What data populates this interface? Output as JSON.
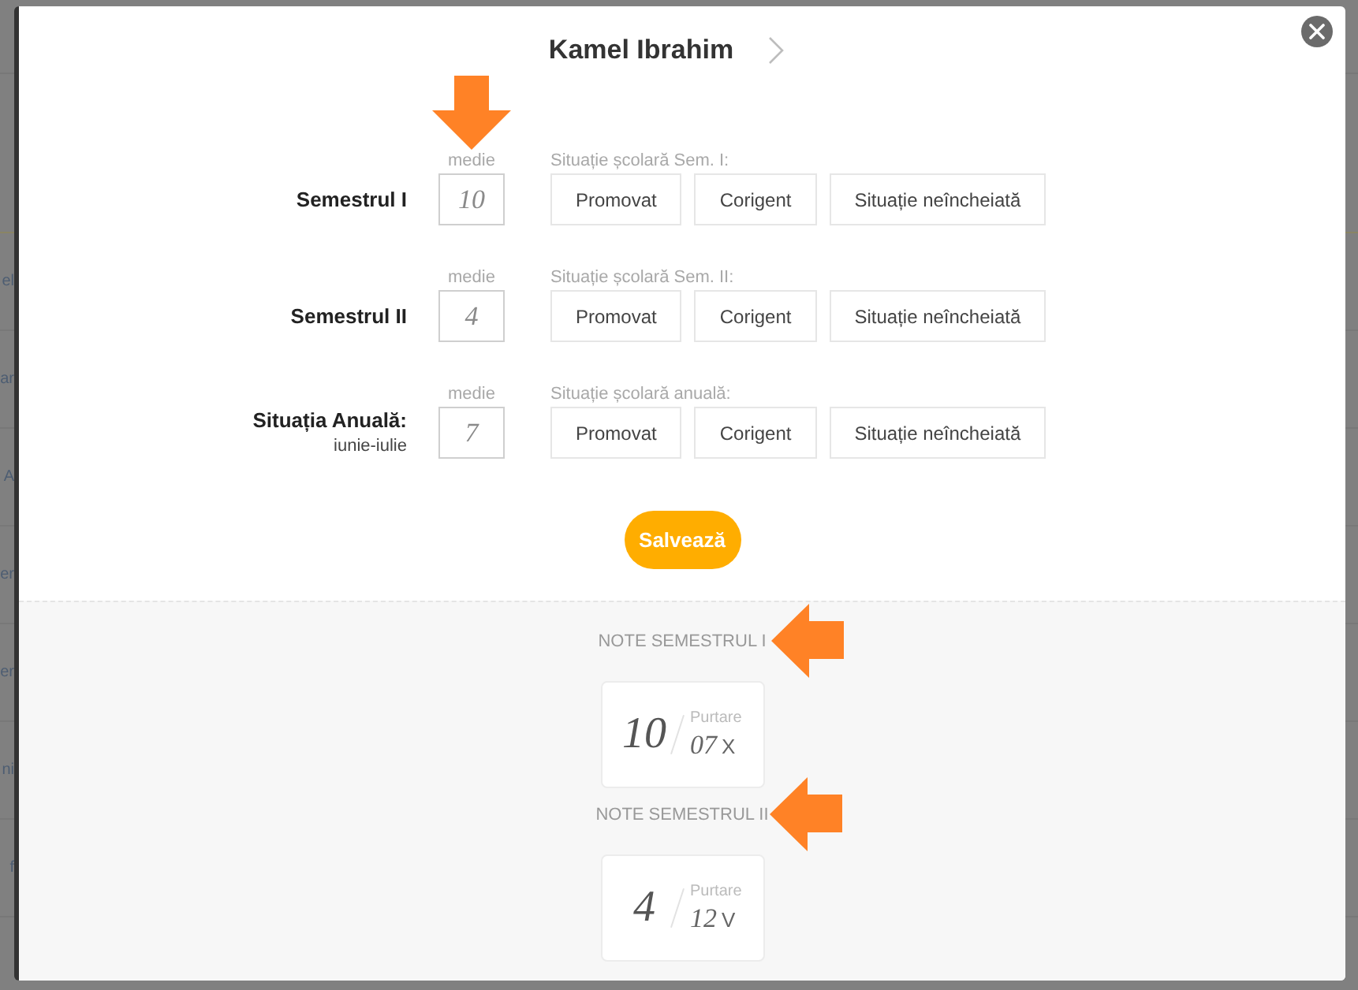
{
  "background_page": {
    "fragments": [
      "el",
      "ar",
      "A",
      "er",
      "er",
      "ni",
      "f"
    ]
  },
  "dialog": {
    "title": "Kamel Ibrahim"
  },
  "rows": [
    {
      "label": "Semestrul I",
      "average_label": "medie",
      "average": "10",
      "status_label": "Situație școlară Sem. I:",
      "options": [
        {
          "label": "Promovat",
          "selected": false
        },
        {
          "label": "Corigent",
          "selected": false
        },
        {
          "label": "Situație neîncheiată",
          "selected": false
        }
      ]
    },
    {
      "label": "Semestrul II",
      "average_label": "medie",
      "average": "4",
      "status_label": "Situație școlară Sem. II:",
      "options": [
        {
          "label": "Promovat",
          "selected": false
        },
        {
          "label": "Corigent",
          "selected": false
        },
        {
          "label": "Situație neîncheiată",
          "selected": false
        }
      ]
    },
    {
      "label": "Situația Anuală:",
      "sublabel": "iunie-iulie",
      "average_label": "medie",
      "average": "7",
      "status_label": "Situație școlară anuală:",
      "options": [
        {
          "label": "Promovat",
          "selected": false
        },
        {
          "label": "Corigent",
          "selected": false
        },
        {
          "label": "Situație neîncheiată",
          "selected": false
        }
      ]
    }
  ],
  "save_button": "Salvează",
  "grades": [
    {
      "heading": "NOTE SEMESTRUL I",
      "grade": "10",
      "conduct_label": "Purtare",
      "conduct_grade": "07",
      "conduct_mark": "X"
    },
    {
      "heading": "NOTE SEMESTRUL II",
      "grade": "4",
      "conduct_label": "Purtare",
      "conduct_grade": "12",
      "conduct_mark": "V"
    }
  ]
}
